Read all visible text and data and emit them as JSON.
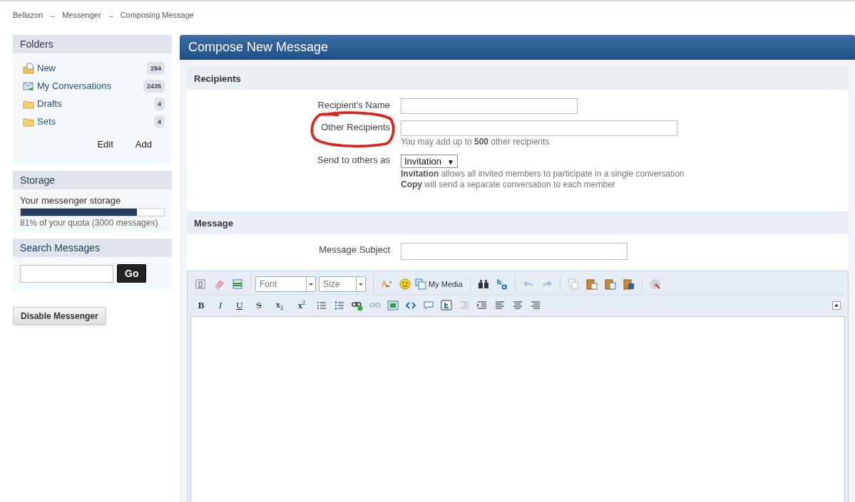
{
  "breadcrumb": {
    "items": [
      "Bellazon",
      "Messenger",
      "Composing Message"
    ],
    "separator": "→"
  },
  "folders": {
    "title": "Folders",
    "items": [
      {
        "label": "New",
        "count": "294",
        "kind": "new"
      },
      {
        "label": "My Conversations",
        "count": "2435",
        "kind": "inbox"
      },
      {
        "label": "Drafts",
        "count": "4",
        "kind": "folder"
      },
      {
        "label": "Sets",
        "count": "4",
        "kind": "folder"
      }
    ],
    "actions": [
      "Edit",
      "Add"
    ]
  },
  "storage": {
    "title": "Storage",
    "label": "Your messenger storage",
    "level": 0.81,
    "caption": "81% of your quota (3000 messages)"
  },
  "search": {
    "title": "Search Messages",
    "button": "Go"
  },
  "disable_button": "Disable Messenger",
  "compose": {
    "title": "Compose New Message",
    "recipients": {
      "heading": "Recipients",
      "name_label": "Recipient's Name",
      "other_label": "Other Recipients",
      "other_hint": "You may add up to **500** other recipients",
      "send_label": "Send to others as",
      "send_value": "Invitation",
      "send_caret": "▼",
      "send_help": [
        "**Invitation** allows all invited members to participate in a single conversation",
        "**Copy** will send a separate conversation to each member"
      ]
    },
    "message": {
      "heading": "Message",
      "subject_label": "Message Subject"
    },
    "editor": {
      "font": "Font",
      "size": "Size",
      "media": "My Media",
      "format_buttons": [
        "B",
        "I",
        "U",
        "S",
        "x$_{2}$",
        "x$^{2}$"
      ]
    }
  }
}
